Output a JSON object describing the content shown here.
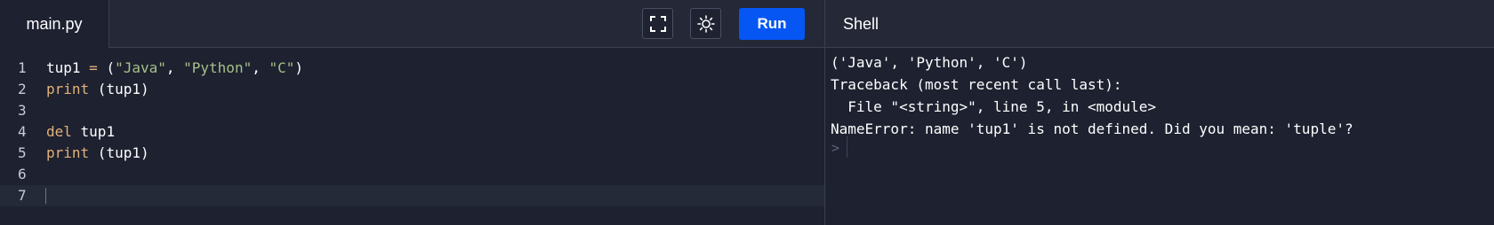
{
  "tabs": {
    "file": "main.py",
    "shell": "Shell"
  },
  "toolbar": {
    "run_label": "Run",
    "fullscreen_icon": "fullscreen-icon",
    "theme_icon": "sun-icon"
  },
  "editor": {
    "line_numbers": [
      "1",
      "2",
      "3",
      "4",
      "5",
      "6",
      "7"
    ],
    "lines": [
      {
        "parts": [
          {
            "t": "tup1 ",
            "c": "plain"
          },
          {
            "t": "=",
            "c": "op"
          },
          {
            "t": " (",
            "c": "plain"
          },
          {
            "t": "\"Java\"",
            "c": "str"
          },
          {
            "t": ", ",
            "c": "plain"
          },
          {
            "t": "\"Python\"",
            "c": "str"
          },
          {
            "t": ", ",
            "c": "plain"
          },
          {
            "t": "\"C\"",
            "c": "str"
          },
          {
            "t": ")",
            "c": "plain"
          }
        ]
      },
      {
        "parts": [
          {
            "t": "print",
            "c": "kw"
          },
          {
            "t": " (tup1)",
            "c": "plain"
          }
        ]
      },
      {
        "parts": []
      },
      {
        "parts": [
          {
            "t": "del",
            "c": "kw"
          },
          {
            "t": " tup1",
            "c": "plain"
          }
        ]
      },
      {
        "parts": [
          {
            "t": "print",
            "c": "kw"
          },
          {
            "t": " (tup1)",
            "c": "plain"
          }
        ]
      },
      {
        "parts": []
      },
      {
        "parts": []
      }
    ],
    "active_line": 7
  },
  "shell": {
    "output": [
      "('Java', 'Python', 'C')",
      "Traceback (most recent call last):",
      "  File \"<string>\", line 5, in <module>",
      "NameError: name 'tup1' is not defined. Did you mean: 'tuple'?"
    ],
    "prompt": ">"
  }
}
